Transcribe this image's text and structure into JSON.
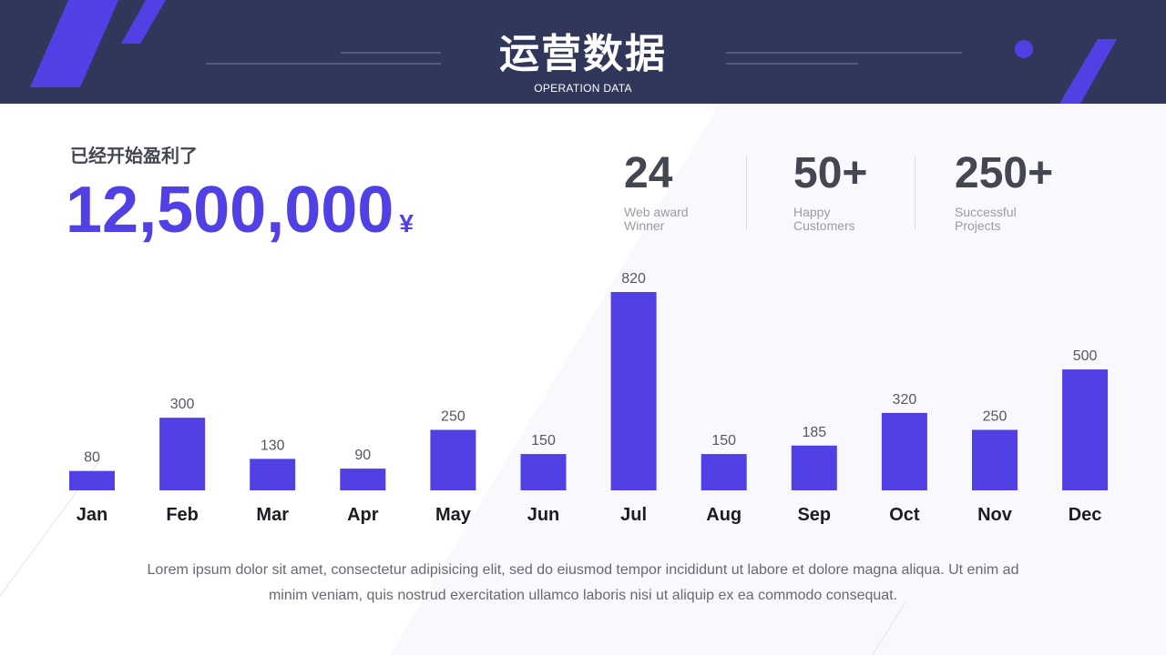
{
  "header": {
    "title": "运营数据",
    "subtitle": "OPERATION DATA"
  },
  "profit": {
    "label": "已经开始盈利了",
    "amount": "12,500,000",
    "currency": "¥"
  },
  "stats": [
    {
      "value": "24",
      "desc_line1": "Web award",
      "desc_line2": "Winner"
    },
    {
      "value": "50+",
      "desc_line1": "Happy",
      "desc_line2": "Customers"
    },
    {
      "value": "250+",
      "desc_line1": "Successful",
      "desc_line2": "Projects"
    }
  ],
  "chart_data": {
    "type": "bar",
    "categories": [
      "Jan",
      "Feb",
      "Mar",
      "Apr",
      "May",
      "Jun",
      "Jul",
      "Aug",
      "Sep",
      "Oct",
      "Nov",
      "Dec"
    ],
    "values": [
      80,
      300,
      130,
      90,
      250,
      150,
      820,
      150,
      185,
      320,
      250,
      500
    ],
    "data_labels": [
      "80",
      "300",
      "130",
      "90",
      "250",
      "150",
      "820",
      "150",
      "185",
      "320",
      "250",
      "500"
    ],
    "title": "",
    "xlabel": "",
    "ylabel": "",
    "ylim": [
      0,
      820
    ],
    "grid": false,
    "legend": "none",
    "bar_color": "#5140e3"
  },
  "footer": {
    "line1": "Lorem ipsum dolor sit amet, consectetur adipisicing elit, sed do eiusmod tempor incididunt ut labore et dolore magna aliqua. Ut enim ad",
    "line2": "minim veniam, quis nostrud exercitation ullamco laboris nisi ut aliquip ex ea commodo consequat."
  },
  "colors": {
    "header_bg": "#31375b",
    "accent": "#5140e3",
    "text_dark": "#444652",
    "text_muted": "#9a9ca6"
  }
}
